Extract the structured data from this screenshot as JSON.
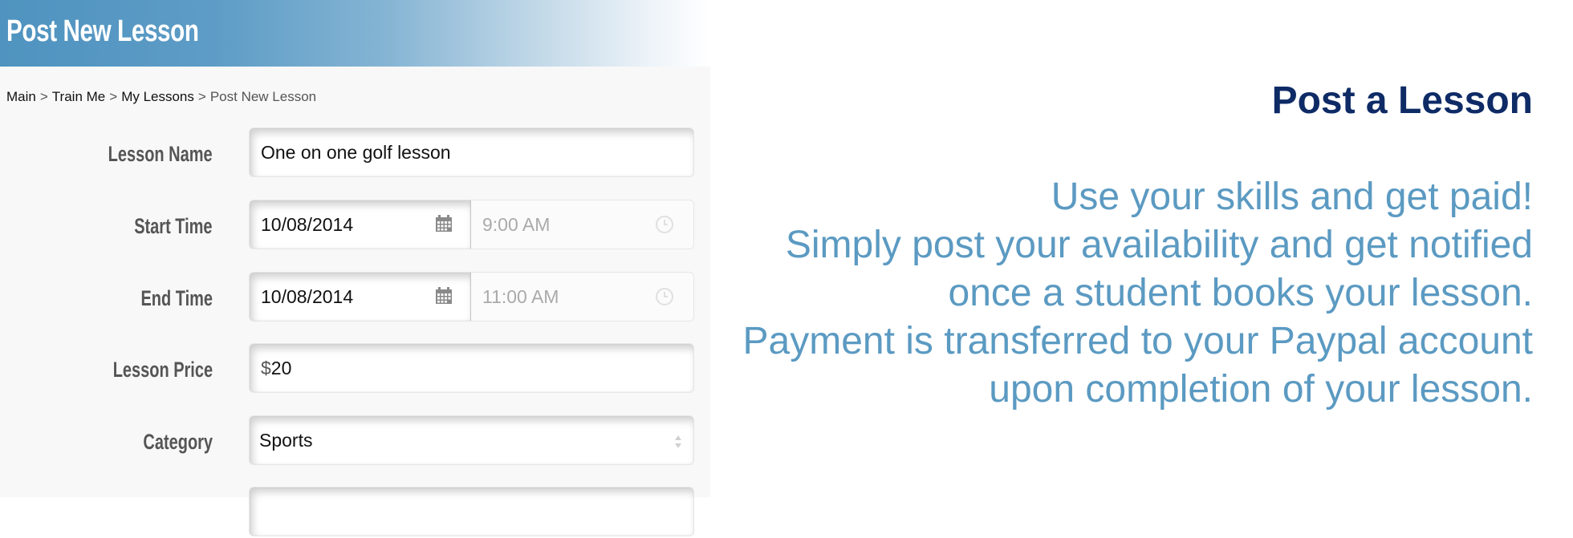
{
  "header": {
    "title": "Post New Lesson"
  },
  "breadcrumb": {
    "items": [
      "Main",
      "Train Me",
      "My Lessons"
    ],
    "current": "Post New Lesson",
    "separator": ">"
  },
  "form": {
    "lesson_name": {
      "label": "Lesson Name",
      "value": "One on one golf lesson"
    },
    "start_time": {
      "label": "Start Time",
      "date": "10/08/2014",
      "time": "9:00 AM"
    },
    "end_time": {
      "label": "End Time",
      "date": "10/08/2014",
      "time": "11:00 AM"
    },
    "lesson_price": {
      "label": "Lesson Price",
      "prefix": "$",
      "value": "20"
    },
    "category": {
      "label": "Category",
      "value": "Sports"
    }
  },
  "promo": {
    "title": "Post a Lesson",
    "lines": [
      "Use your skills and get paid!",
      "Simply post your availability and get notified",
      "once a student books your lesson.",
      "Payment is transferred to your Paypal account",
      "upon completion of your lesson."
    ]
  },
  "colors": {
    "header_blue": "#4f93c0",
    "promo_title": "#0e2b66",
    "promo_text": "#5b9ac2"
  }
}
